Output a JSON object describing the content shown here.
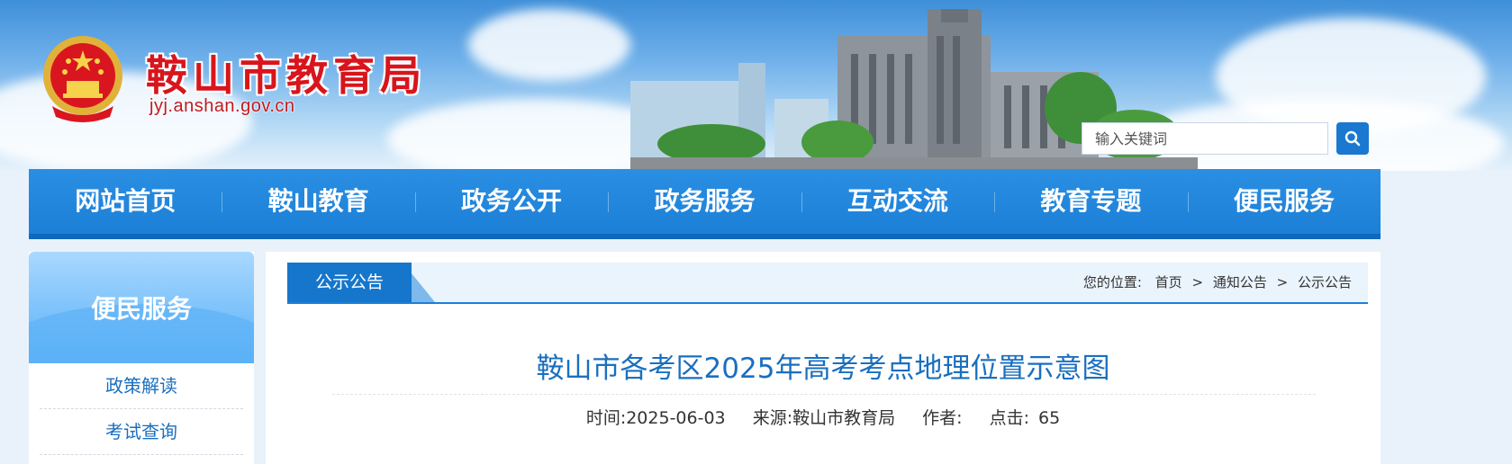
{
  "header": {
    "site_title": "鞍山市教育局",
    "site_domain": "jyj.anshan.gov.cn",
    "search_placeholder": "输入关键词"
  },
  "nav": {
    "items": [
      "网站首页",
      "鞍山教育",
      "政务公开",
      "政务服务",
      "互动交流",
      "教育专题",
      "便民服务"
    ]
  },
  "sidebar": {
    "title": "便民服务",
    "items": [
      "政策解读",
      "考试查询"
    ]
  },
  "breadcrumb": {
    "tab_label": "公示公告",
    "location_label": "您的位置:",
    "path": [
      "首页",
      "通知公告",
      "公示公告"
    ],
    "separator": ">"
  },
  "article": {
    "title": "鞍山市各考区2025年高考考点地理位置示意图",
    "time": "时间:2025-06-03",
    "source": "来源:鞍山市教育局",
    "author": "作者:",
    "clicks_label": "点击:",
    "clicks_value": "65"
  },
  "colors": {
    "brand_red": "#d8151c",
    "nav_blue": "#1c7fd7",
    "link_blue": "#1a6fbf"
  },
  "icons": {
    "emblem": "national-emblem-icon",
    "search": "search-icon"
  }
}
